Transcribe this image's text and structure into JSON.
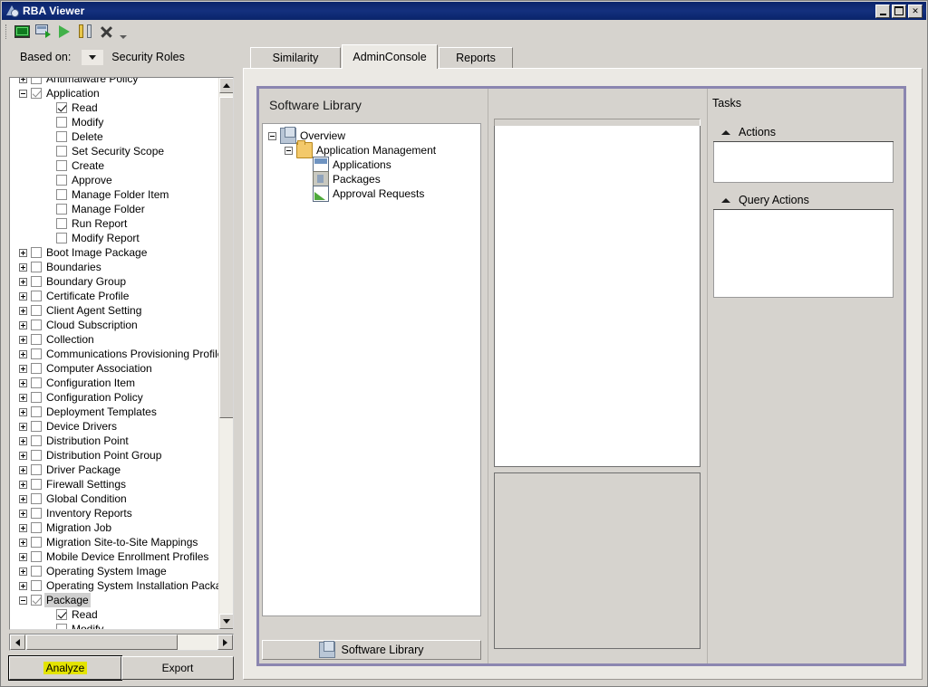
{
  "window": {
    "title": "RBA Viewer",
    "icon": "rba-viewer-icon",
    "controls": {
      "minimize": "minimize-button",
      "maximize": "maximize-button",
      "close": "close-button",
      "close_glyph": "✕"
    }
  },
  "toolbar": {
    "items": [
      {
        "name": "connect-icon",
        "icon": "monitor-icon"
      },
      {
        "name": "export-icon",
        "icon": "screen-export-icon"
      },
      {
        "name": "run-icon",
        "icon": "play-icon"
      },
      {
        "name": "options-icon",
        "icon": "tools-icon"
      },
      {
        "name": "clear-icon",
        "icon": "x-icon"
      }
    ],
    "overflow": "toolbar-overflow-chevron"
  },
  "based_on": {
    "label": "Based on:",
    "value": "Security Roles"
  },
  "tree": {
    "rows": [
      {
        "label": "Antimalware Policy",
        "indent": 0,
        "expander": "plus",
        "checked": false
      },
      {
        "label": "Application",
        "indent": 0,
        "expander": "minus",
        "checked": "gray"
      },
      {
        "label": "Read",
        "indent": 1,
        "expander": "none",
        "checked": true
      },
      {
        "label": "Modify",
        "indent": 1,
        "expander": "none",
        "checked": false
      },
      {
        "label": "Delete",
        "indent": 1,
        "expander": "none",
        "checked": false
      },
      {
        "label": "Set Security Scope",
        "indent": 1,
        "expander": "none",
        "checked": false
      },
      {
        "label": "Create",
        "indent": 1,
        "expander": "none",
        "checked": false
      },
      {
        "label": "Approve",
        "indent": 1,
        "expander": "none",
        "checked": false
      },
      {
        "label": "Manage Folder Item",
        "indent": 1,
        "expander": "none",
        "checked": false
      },
      {
        "label": "Manage Folder",
        "indent": 1,
        "expander": "none",
        "checked": false
      },
      {
        "label": "Run Report",
        "indent": 1,
        "expander": "none",
        "checked": false
      },
      {
        "label": "Modify Report",
        "indent": 1,
        "expander": "none",
        "checked": false
      },
      {
        "label": "Boot Image Package",
        "indent": 0,
        "expander": "plus",
        "checked": false
      },
      {
        "label": "Boundaries",
        "indent": 0,
        "expander": "plus",
        "checked": false
      },
      {
        "label": "Boundary Group",
        "indent": 0,
        "expander": "plus",
        "checked": false
      },
      {
        "label": "Certificate Profile",
        "indent": 0,
        "expander": "plus",
        "checked": false
      },
      {
        "label": "Client Agent Setting",
        "indent": 0,
        "expander": "plus",
        "checked": false
      },
      {
        "label": "Cloud Subscription",
        "indent": 0,
        "expander": "plus",
        "checked": false
      },
      {
        "label": "Collection",
        "indent": 0,
        "expander": "plus",
        "checked": false
      },
      {
        "label": "Communications Provisioning Profile",
        "indent": 0,
        "expander": "plus",
        "checked": false
      },
      {
        "label": "Computer Association",
        "indent": 0,
        "expander": "plus",
        "checked": false
      },
      {
        "label": "Configuration Item",
        "indent": 0,
        "expander": "plus",
        "checked": false
      },
      {
        "label": "Configuration Policy",
        "indent": 0,
        "expander": "plus",
        "checked": false
      },
      {
        "label": "Deployment Templates",
        "indent": 0,
        "expander": "plus",
        "checked": false
      },
      {
        "label": "Device Drivers",
        "indent": 0,
        "expander": "plus",
        "checked": false
      },
      {
        "label": "Distribution Point",
        "indent": 0,
        "expander": "plus",
        "checked": false
      },
      {
        "label": "Distribution Point Group",
        "indent": 0,
        "expander": "plus",
        "checked": false
      },
      {
        "label": "Driver Package",
        "indent": 0,
        "expander": "plus",
        "checked": false
      },
      {
        "label": "Firewall Settings",
        "indent": 0,
        "expander": "plus",
        "checked": false
      },
      {
        "label": "Global Condition",
        "indent": 0,
        "expander": "plus",
        "checked": false
      },
      {
        "label": "Inventory Reports",
        "indent": 0,
        "expander": "plus",
        "checked": false
      },
      {
        "label": "Migration Job",
        "indent": 0,
        "expander": "plus",
        "checked": false
      },
      {
        "label": "Migration Site-to-Site Mappings",
        "indent": 0,
        "expander": "plus",
        "checked": false
      },
      {
        "label": "Mobile Device Enrollment Profiles",
        "indent": 0,
        "expander": "plus",
        "checked": false
      },
      {
        "label": "Operating System Image",
        "indent": 0,
        "expander": "plus",
        "checked": false
      },
      {
        "label": "Operating System Installation Package",
        "indent": 0,
        "expander": "plus",
        "checked": false
      },
      {
        "label": "Package",
        "indent": 0,
        "expander": "minus",
        "checked": "gray",
        "selected": true
      },
      {
        "label": "Read",
        "indent": 1,
        "expander": "none",
        "checked": true
      },
      {
        "label": "Modify",
        "indent": 1,
        "expander": "none",
        "checked": false
      }
    ]
  },
  "buttons": {
    "analyze": "Analyze",
    "export": "Export"
  },
  "tabs": [
    {
      "label": "Similarity",
      "name": "tab-similarity",
      "active": false
    },
    {
      "label": "AdminConsole",
      "name": "tab-adminconsole",
      "active": true
    },
    {
      "label": "Reports",
      "name": "tab-reports",
      "active": false
    }
  ],
  "console": {
    "software_library": {
      "title": "Software Library",
      "footer_label": "Software Library",
      "footer_icon": "cube-icon",
      "nodes": [
        {
          "label": "Overview",
          "indent": 0,
          "expander": "minus",
          "icon": "cube-icon"
        },
        {
          "label": "Application Management",
          "indent": 1,
          "expander": "minus",
          "icon": "folder-icon"
        },
        {
          "label": "Applications",
          "indent": 2,
          "expander": "none",
          "icon": "applications-icon"
        },
        {
          "label": "Packages",
          "indent": 2,
          "expander": "none",
          "icon": "packages-icon"
        },
        {
          "label": "Approval Requests",
          "indent": 2,
          "expander": "none",
          "icon": "approval-requests-icon"
        }
      ]
    },
    "tasks": {
      "title": "Tasks",
      "groups": [
        {
          "label": "Actions",
          "name": "group-actions",
          "expanded": true
        },
        {
          "label": "Query Actions",
          "name": "group-query-actions",
          "expanded": true
        }
      ]
    }
  },
  "colors": {
    "titlebar": "#0a246a",
    "face": "#d6d3ce",
    "console_border": "#8b86b0",
    "highlight_yellow": "#e3e300"
  }
}
